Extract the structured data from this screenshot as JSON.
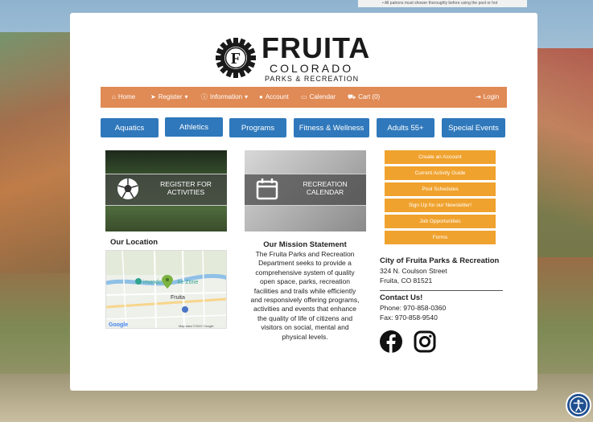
{
  "top_strip_text": "• All patrons must shower thoroughly before using the pool or hot",
  "brand": {
    "name": "FRUITA",
    "subtitle": "COLORADO",
    "tagline": "PARKS & RECREATION",
    "logo_letter": "F",
    "accent_color": "#e08a55",
    "button_color": "#2f78bb",
    "quick_link_color": "#f0a22e"
  },
  "nav": {
    "home": "Home",
    "register": "Register",
    "information": "Information",
    "account": "Account",
    "calendar": "Calendar",
    "cart": "Cart (0)",
    "login": "Login"
  },
  "categories": [
    "Aquatics",
    "Athletics",
    "Programs",
    "Fitness & Wellness",
    "Adults 55+",
    "Special Events"
  ],
  "tiles": {
    "register": "REGISTER FOR ACTIVITIES",
    "register_line1": "REGISTER FOR",
    "register_line2": "ACTIVITIES",
    "calendar_line1": "RECREATION",
    "calendar_line2": "CALENDAR"
  },
  "quick_links": [
    "Create an Account",
    "Current Activity Guide",
    "Pool Schedules",
    "Sign Up for our Newsletter!",
    "Job Opportunities",
    "Forms"
  ],
  "location": {
    "title": "Our Location",
    "map_label_park": "imondo",
    "map_label_zone": "ke Zone",
    "map_label_town": "Fruita",
    "map_google": "Google",
    "map_credit": "Map data ©2022 Google"
  },
  "mission": {
    "title": "Our Mission Statement",
    "lines": [
      "The Fruita Parks and Recreation",
      "Department seeks to provide a",
      "comprehensive system of quality",
      "open space, parks, recreation",
      "facilities and trails while efficiently",
      "and responsively offering programs,",
      "activities and events that enhance",
      "the quality of life of citizens and",
      "visitors on social, mental and",
      "physical levels."
    ]
  },
  "contact": {
    "org": "City of Fruita Parks & Recreation",
    "address1": "324 N. Coulson Street",
    "address2": "Fruita, CO 81521",
    "heading": "Contact Us!",
    "phone": "Phone: 970-858-0360",
    "fax": "Fax: 970-858-9540"
  }
}
